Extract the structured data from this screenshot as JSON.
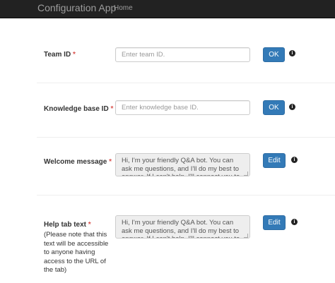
{
  "navbar": {
    "brand": "Configuration App",
    "home_link": "Home"
  },
  "form": {
    "required_marker": "*",
    "team_id": {
      "label": "Team ID",
      "placeholder": "Enter team ID.",
      "button": "OK",
      "info_icon": "info-circle-icon"
    },
    "kb_id": {
      "label": "Knowledge base ID",
      "placeholder": "Enter knowledge base ID.",
      "button": "OK",
      "info_icon": "info-circle-icon"
    },
    "welcome": {
      "label": "Welcome message",
      "value": "Hi, I'm your friendly Q&A bot. You can ask me questions, and I'll do my best to answer. If I can't help, I'll connect you to a person.",
      "button": "Edit",
      "info_icon": "info-circle-icon"
    },
    "help_tab": {
      "label": "Help tab text",
      "note": "(Please note that this text will be accessible to anyone having access to the URL of the tab)",
      "value": "Hi, I'm your friendly Q&A bot. You can ask me questions, and I'll do my best to answer. If I can't help, I'll connect you to a person.",
      "button": "Edit",
      "info_icon": "info-circle-icon"
    }
  }
}
